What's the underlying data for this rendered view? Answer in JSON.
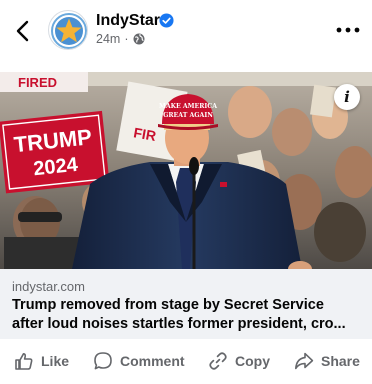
{
  "post": {
    "page_name": "IndyStar",
    "time": "24m",
    "separator": "·",
    "verified": true,
    "privacy_icon": "globe-icon"
  },
  "photo": {
    "info_label": "i",
    "sign_trump": "TRUMP",
    "sign_year": "2024",
    "sign_fired": "FIRED",
    "hat_line1": "MAKE AMERICA",
    "hat_line2": "GREAT AGAIN"
  },
  "link": {
    "domain": "indystar.com",
    "headline_line1": "Trump removed from stage by Secret Service",
    "headline_line2": "after loud noises startles former president, cro..."
  },
  "actions": {
    "like": "Like",
    "comment": "Comment",
    "copy": "Copy",
    "share": "Share"
  },
  "colors": {
    "accent": "#1877f2",
    "text_secondary": "#65676b",
    "card_bg": "#f0f2f5",
    "hat_red": "#c8102e",
    "suit_navy": "#1c2a44"
  }
}
